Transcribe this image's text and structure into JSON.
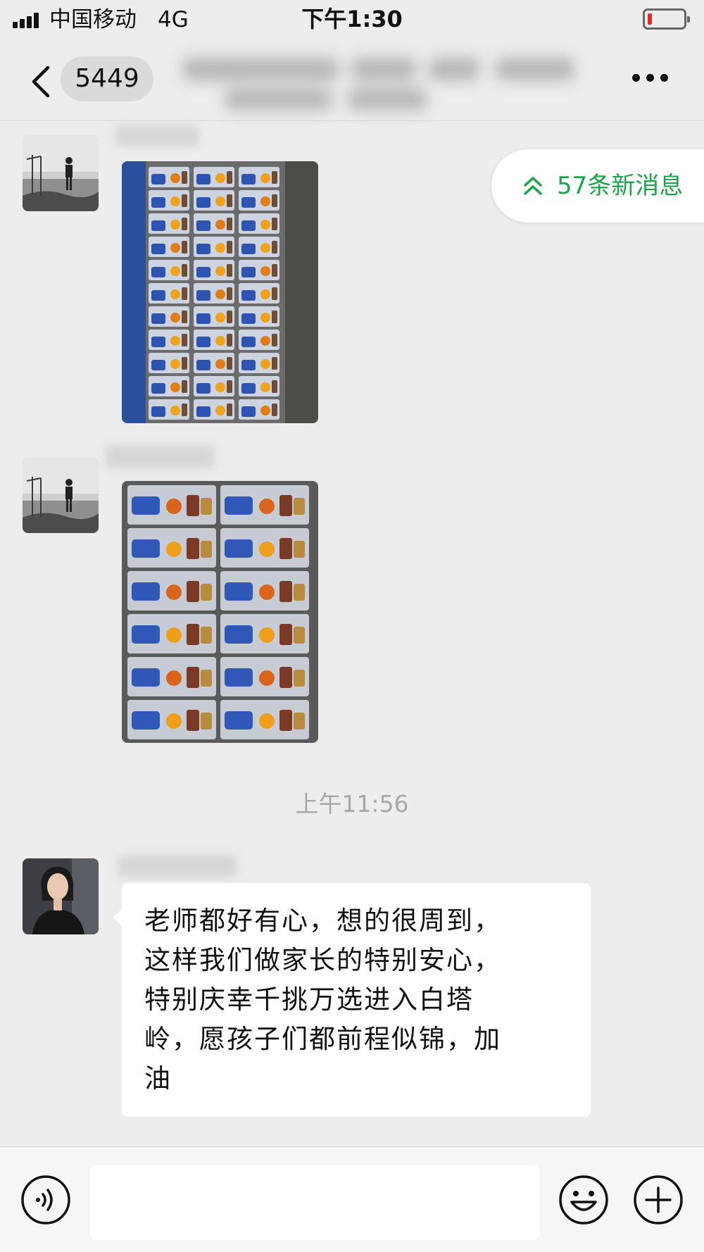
{
  "status_bar": {
    "carrier": "中国移动",
    "network": "4G",
    "time": "下午1:30",
    "battery_level": 0.12
  },
  "nav": {
    "back_icon": "chevron-left-icon",
    "unread_count": "5449",
    "more_icon": "more-dots-icon"
  },
  "new_messages": {
    "label": "57条新消息",
    "icon": "double-chevron-up-icon",
    "color": "#19a64a"
  },
  "messages": [
    {
      "type": "image",
      "content": "photo of packed snack bags"
    },
    {
      "type": "image",
      "content": "photo of packed snack bags"
    },
    {
      "type": "text",
      "lines": [
        "老师都好有心，想的很周到，",
        "这样我们做家长的特别安心，",
        "特别庆幸千挑万选进入白塔",
        "岭，愿孩子们都前程似锦，加",
        "油"
      ]
    }
  ],
  "timestamp": "上午11:56",
  "input_bar": {
    "voice_icon": "voice-icon",
    "emoji_icon": "emoji-icon",
    "plus_icon": "plus-icon",
    "input_value": ""
  },
  "colors": {
    "background": "#ededed",
    "bubble": "#ffffff",
    "accent": "#19a64a"
  }
}
